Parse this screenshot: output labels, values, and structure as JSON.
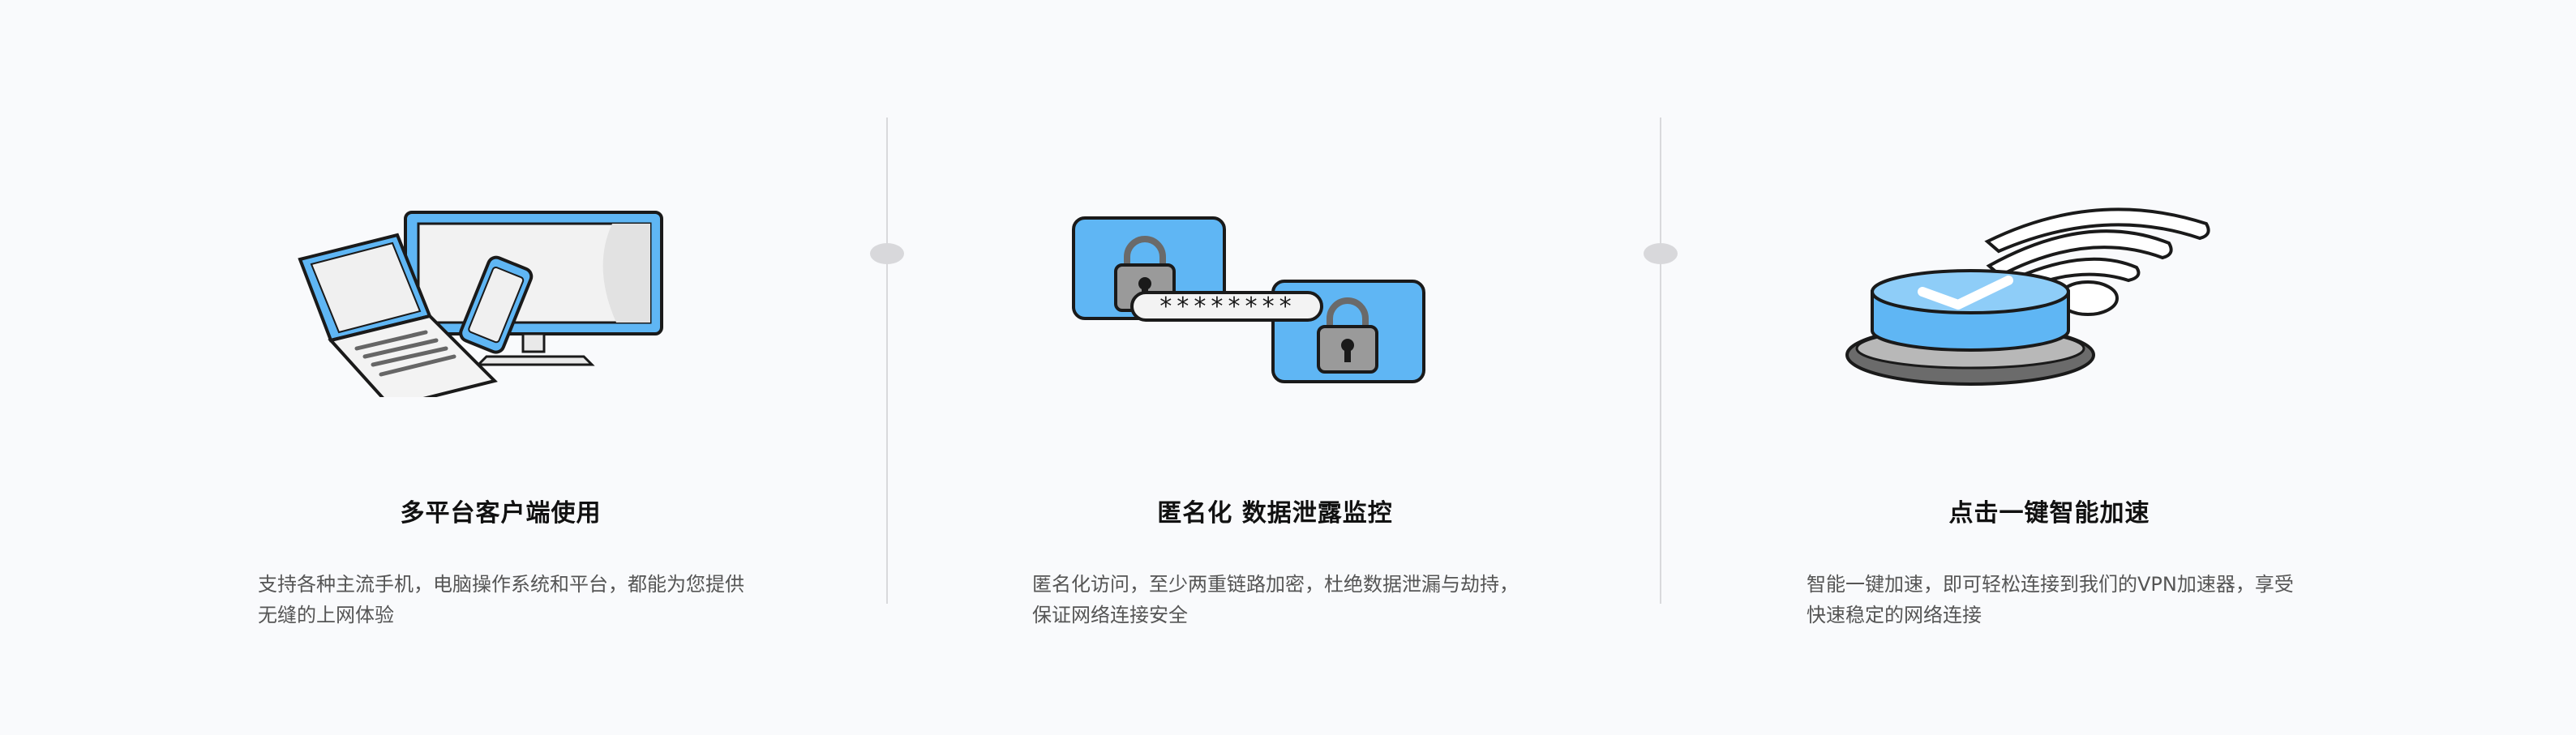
{
  "features": [
    {
      "title": "多平台客户端使用",
      "description": "支持各种主流手机，电脑操作系统和平台，都能为您提供无缝的上网体验",
      "icon": "multi-device-icon"
    },
    {
      "title": "匿名化 数据泄露监控",
      "description": "匿名化访问，至少两重链路加密，杜绝数据泄漏与劫持，保证网络连接安全",
      "icon": "lock-password-icon",
      "password_mask": "********"
    },
    {
      "title": "点击一键智能加速",
      "description": "智能一键加速，即可轻松连接到我们的VPN加速器，享受快速稳定的网络连接",
      "icon": "one-click-accelerate-icon"
    }
  ],
  "colors": {
    "background": "#f9fafc",
    "accent_blue": "#5fb6f4",
    "outline": "#1a1a1a",
    "divider": "#d9d9dc"
  }
}
